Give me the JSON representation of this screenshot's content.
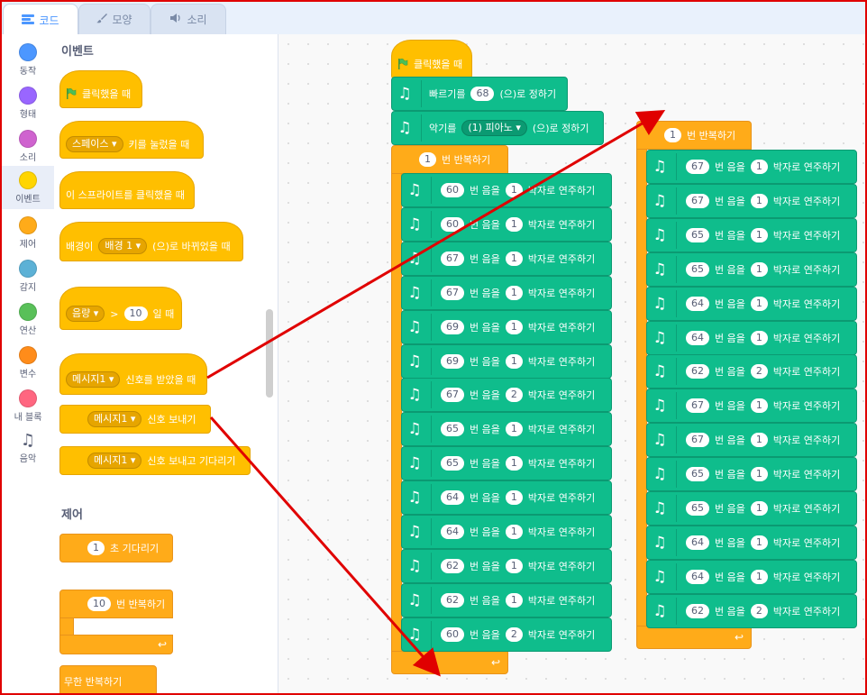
{
  "tabs": [
    {
      "label": "코드",
      "icon": "code-icon"
    },
    {
      "label": "모양",
      "icon": "brush-icon"
    },
    {
      "label": "소리",
      "icon": "speaker-icon"
    }
  ],
  "categories": [
    {
      "label": "동작",
      "color": "#4c97ff"
    },
    {
      "label": "형태",
      "color": "#9966ff"
    },
    {
      "label": "소리",
      "color": "#cf63cf"
    },
    {
      "label": "이벤트",
      "color": "#ffd500"
    },
    {
      "label": "제어",
      "color": "#ffab19"
    },
    {
      "label": "감지",
      "color": "#5cb1d6"
    },
    {
      "label": "연산",
      "color": "#59c059"
    },
    {
      "label": "변수",
      "color": "#ff8c1a"
    },
    {
      "label": "내 블록",
      "color": "#ff6680"
    },
    {
      "label": "음악",
      "icon": "music-note-icon"
    }
  ],
  "palette": {
    "events_heading": "이벤트",
    "control_heading": "제어",
    "when_flag": "클릭했을 때",
    "key_dropdown": "스페이스",
    "key_label": "키를 눌렀을 때",
    "sprite_clicked": "이 스프라이트를 클릭했을 때",
    "backdrop_prefix": "배경이",
    "backdrop_dropdown": "배경 1",
    "backdrop_suffix": "(으)로 바뀌었을 때",
    "loudness_dropdown": "음량",
    "gt_symbol": ">",
    "loudness_value": "10",
    "loudness_suffix": "일 때",
    "receive_dropdown": "메시지1",
    "receive_label": "신호를 받았을 때",
    "broadcast_dropdown": "메시지1",
    "broadcast_label": "신호 보내기",
    "broadcast_wait_dropdown": "메시지1",
    "broadcast_wait_label": "신호 보내고 기다리기",
    "wait_value": "1",
    "wait_label": "초 기다리기",
    "repeat_value": "10",
    "repeat_label": "번 반복하기",
    "forever_label": "무한 반복하기"
  },
  "script1": {
    "hat_label": "클릭했을 때",
    "tempo_prefix": "빠르기를",
    "tempo_value": "68",
    "tempo_suffix": "(으)로 정하기",
    "instrument_prefix": "악기를",
    "instrument_value": "(1) 피아노",
    "instrument_suffix": "(으)로 정하기",
    "repeat_value": "1",
    "repeat_label": "번 반복하기",
    "note_label": "번 음을",
    "beat_label": "박자로 연주하기",
    "notes": [
      {
        "note": "60",
        "beats": "1"
      },
      {
        "note": "60",
        "beats": "1"
      },
      {
        "note": "67",
        "beats": "1"
      },
      {
        "note": "67",
        "beats": "1"
      },
      {
        "note": "69",
        "beats": "1"
      },
      {
        "note": "69",
        "beats": "1"
      },
      {
        "note": "67",
        "beats": "2"
      },
      {
        "note": "65",
        "beats": "1"
      },
      {
        "note": "65",
        "beats": "1"
      },
      {
        "note": "64",
        "beats": "1"
      },
      {
        "note": "64",
        "beats": "1"
      },
      {
        "note": "62",
        "beats": "1"
      },
      {
        "note": "62",
        "beats": "1"
      },
      {
        "note": "60",
        "beats": "2"
      }
    ]
  },
  "script2": {
    "repeat_value": "1",
    "repeat_label": "번 반복하기",
    "note_label": "번 음을",
    "beat_label": "박자로 연주하기",
    "notes": [
      {
        "note": "67",
        "beats": "1"
      },
      {
        "note": "67",
        "beats": "1"
      },
      {
        "note": "65",
        "beats": "1"
      },
      {
        "note": "65",
        "beats": "1"
      },
      {
        "note": "64",
        "beats": "1"
      },
      {
        "note": "64",
        "beats": "1"
      },
      {
        "note": "62",
        "beats": "2"
      },
      {
        "note": "67",
        "beats": "1"
      },
      {
        "note": "67",
        "beats": "1"
      },
      {
        "note": "65",
        "beats": "1"
      },
      {
        "note": "65",
        "beats": "1"
      },
      {
        "note": "64",
        "beats": "1"
      },
      {
        "note": "64",
        "beats": "1"
      },
      {
        "note": "62",
        "beats": "2"
      }
    ]
  },
  "colors": {
    "annotation": "#e00000",
    "events": "#ffbf00",
    "control": "#ffab19",
    "music": "#0fbd8c",
    "accent": "#4c97ff"
  }
}
